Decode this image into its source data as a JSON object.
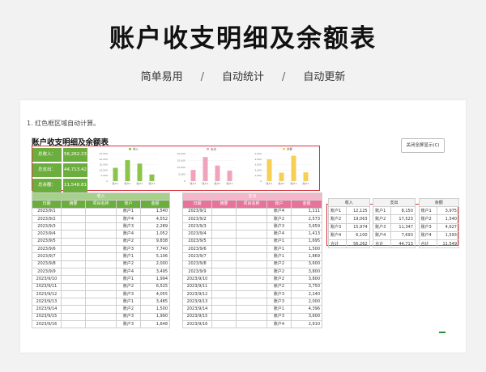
{
  "hero": {
    "title": "账户收支明细及余额表",
    "features": [
      "简单易用",
      "自动统计",
      "自动更新"
    ],
    "separator": "/"
  },
  "sheet": {
    "note": "1. 红色框区域自动计算。",
    "title": "账户收支明细及余额表",
    "toggle_button": "关闭全屏显示(C)"
  },
  "kpis": [
    {
      "label": "总收入：",
      "value": "56,262.23"
    },
    {
      "label": "总支出：",
      "value": "44,713.42"
    },
    {
      "label": "总余额：",
      "value": "11,548.81"
    }
  ],
  "colors": {
    "income": "#8cc34a",
    "expense": "#f0a3bd",
    "balance": "#f7cf55",
    "red_frame": "#d9333f",
    "green_header": "#6cae3e",
    "pink_header": "#e8739a"
  },
  "chart_data": [
    {
      "type": "bar",
      "series": [
        {
          "name": "收入",
          "values": [
            12125,
            19063,
            15974,
            6100
          ]
        }
      ],
      "categories": [
        "账户1",
        "账户2",
        "账户3",
        "账户4"
      ],
      "yticks": [
        "25,000",
        "20,000",
        "15,000",
        "10,000",
        "5,000",
        "0"
      ],
      "ylim": [
        0,
        25000
      ],
      "legend": "top"
    },
    {
      "type": "bar",
      "series": [
        {
          "name": "支出",
          "values": [
            8150,
            17523,
            11347,
            7693
          ]
        }
      ],
      "categories": [
        "账户1",
        "账户2",
        "账户3",
        "账户4"
      ],
      "yticks": [
        "20,000",
        "15,000",
        "10,000",
        "5,000",
        "0"
      ],
      "ylim": [
        0,
        20000
      ],
      "legend": "top"
    },
    {
      "type": "bar",
      "series": [
        {
          "name": "余额",
          "values": [
            3975,
            1540,
            4627,
            1593
          ]
        }
      ],
      "categories": [
        "账户1",
        "账户2",
        "账户3",
        "账户4"
      ],
      "yticks": [
        "5,000",
        "4,000",
        "3,000",
        "2,000",
        "1,000",
        "0"
      ],
      "ylim": [
        0,
        5000
      ],
      "legend": "top"
    }
  ],
  "income_table": {
    "section_label": "收入",
    "headers": [
      "日期",
      "摘要",
      "项目名称",
      "账户",
      "金额"
    ],
    "rows": [
      [
        "2023/9/1",
        "",
        "",
        "账户1",
        "1,540"
      ],
      [
        "2023/9/2",
        "",
        "",
        "账户4",
        "4,552"
      ],
      [
        "2023/9/3",
        "",
        "",
        "账户3",
        "2,289"
      ],
      [
        "2023/9/4",
        "",
        "",
        "账户4",
        "1,052"
      ],
      [
        "2023/9/5",
        "",
        "",
        "账户2",
        "9,838"
      ],
      [
        "2023/9/6",
        "",
        "",
        "账户3",
        "7,740"
      ],
      [
        "2023/9/7",
        "",
        "",
        "账户1",
        "5,106"
      ],
      [
        "2023/9/8",
        "",
        "",
        "账户2",
        "2,000"
      ],
      [
        "2023/9/9",
        "",
        "",
        "账户4",
        "3,495"
      ],
      [
        "2023/9/10",
        "",
        "",
        "账户1",
        "1,994"
      ],
      [
        "2023/9/11",
        "",
        "",
        "账户2",
        "6,525"
      ],
      [
        "2023/9/12",
        "",
        "",
        "账户3",
        "4,055"
      ],
      [
        "2023/9/13",
        "",
        "",
        "账户1",
        "3,485"
      ],
      [
        "2023/9/14",
        "",
        "",
        "账户2",
        "1,500"
      ],
      [
        "2023/9/15",
        "",
        "",
        "账户3",
        "1,990"
      ],
      [
        "2023/9/16",
        "",
        "",
        "账户3",
        "1,648"
      ]
    ]
  },
  "expense_table": {
    "section_label": "支出",
    "headers": [
      "日期",
      "摘要",
      "项目名称",
      "账户",
      "金额"
    ],
    "rows": [
      [
        "2023/9/1",
        "",
        "",
        "账户4",
        "1,111"
      ],
      [
        "2023/9/2",
        "",
        "",
        "账户2",
        "2,573"
      ],
      [
        "2023/9/3",
        "",
        "",
        "账户3",
        "3,659"
      ],
      [
        "2023/9/4",
        "",
        "",
        "账户4",
        "1,413"
      ],
      [
        "2023/9/5",
        "",
        "",
        "账户1",
        "1,695"
      ],
      [
        "2023/9/6",
        "",
        "",
        "账户1",
        "1,500"
      ],
      [
        "2023/9/7",
        "",
        "",
        "账户1",
        "1,869"
      ],
      [
        "2023/9/8",
        "",
        "",
        "账户2",
        "3,600"
      ],
      [
        "2023/9/9",
        "",
        "",
        "账户2",
        "3,800"
      ],
      [
        "2023/9/10",
        "",
        "",
        "账户2",
        "3,800"
      ],
      [
        "2023/9/11",
        "",
        "",
        "账户2",
        "3,750"
      ],
      [
        "2023/9/12",
        "",
        "",
        "账户3",
        "2,240"
      ],
      [
        "2023/9/13",
        "",
        "",
        "账户3",
        "2,000"
      ],
      [
        "2023/9/14",
        "",
        "",
        "账户1",
        "4,396"
      ],
      [
        "2023/9/15",
        "",
        "",
        "账户3",
        "3,600"
      ],
      [
        "2023/9/16",
        "",
        "",
        "账户4",
        "2,910"
      ]
    ]
  },
  "summary": {
    "income": {
      "title": "收入",
      "rows": [
        [
          "账户1",
          "12,125"
        ],
        [
          "账户2",
          "19,063"
        ],
        [
          "账户3",
          "15,974"
        ],
        [
          "账户4",
          "6,100"
        ],
        [
          "合计",
          "56,262"
        ]
      ]
    },
    "expense": {
      "title": "支出",
      "rows": [
        [
          "账户1",
          "8,150"
        ],
        [
          "账户2",
          "17,523"
        ],
        [
          "账户3",
          "11,347"
        ],
        [
          "账户4",
          "7,693"
        ],
        [
          "合计",
          "44,713"
        ]
      ]
    },
    "balance": {
      "title": "余额",
      "rows": [
        [
          "账户1",
          "3,975"
        ],
        [
          "账户2",
          "1,540"
        ],
        [
          "账户3",
          "4,627"
        ],
        [
          "账户4",
          "1,593"
        ],
        [
          "合计",
          "11,549"
        ]
      ]
    }
  }
}
